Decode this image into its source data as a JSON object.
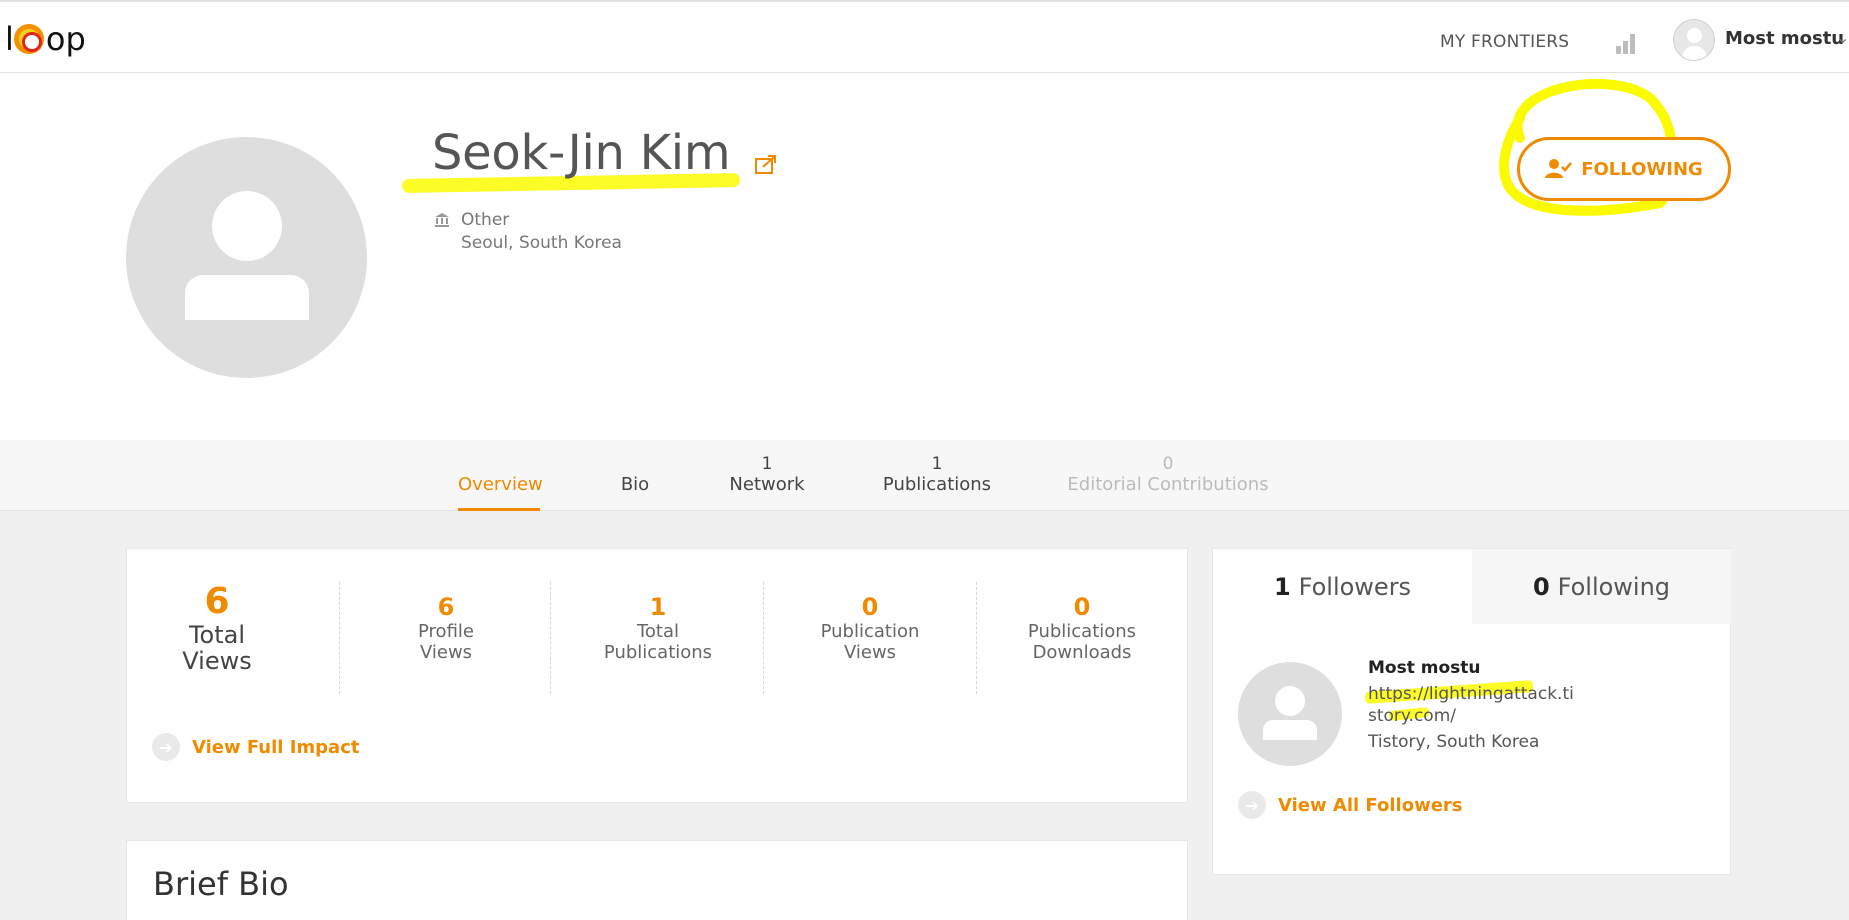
{
  "header": {
    "logo_letters": [
      "l",
      "op"
    ],
    "nav_frontiers": "MY FRONTIERS",
    "user_name": "Most mostu",
    "chevron": "⌄"
  },
  "profile": {
    "name": "Seok-Jin Kim",
    "institution": "Other",
    "location": "Seoul, South Korea",
    "follow_button": "FOLLOWING"
  },
  "tabs": [
    {
      "label": "Overview",
      "count": ""
    },
    {
      "label": "Bio",
      "count": ""
    },
    {
      "label": "Network",
      "count": "1"
    },
    {
      "label": "Publications",
      "count": "1"
    },
    {
      "label": "Editorial Contributions",
      "count": "0"
    }
  ],
  "impact": {
    "total_views": {
      "value": "6",
      "label_1": "Total",
      "label_2": "Views"
    },
    "stats": [
      {
        "value": "6",
        "label_1": "Profile",
        "label_2": "Views"
      },
      {
        "value": "1",
        "label_1": "Total",
        "label_2": "Publications"
      },
      {
        "value": "0",
        "label_1": "Publication",
        "label_2": "Views"
      },
      {
        "value": "0",
        "label_1": "Publications",
        "label_2": "Downloads"
      }
    ],
    "link": "View Full Impact"
  },
  "bio": {
    "title": "Brief Bio"
  },
  "followers": {
    "followers_count": "1",
    "followers_label": "Followers",
    "following_count": "0",
    "following_label": "Following",
    "item": {
      "name": "Most mostu",
      "url": "https://lightningattack.tistory.com/",
      "location": "Tistory, South Korea"
    },
    "link": "View All Followers"
  },
  "colors": {
    "accent": "#f08a00",
    "highlight": "#fbfb00"
  },
  "icons": [
    "share-icon",
    "institution-icon",
    "user-check-icon",
    "bar-chart-icon",
    "arrow-right-icon",
    "chevron-down-icon"
  ]
}
